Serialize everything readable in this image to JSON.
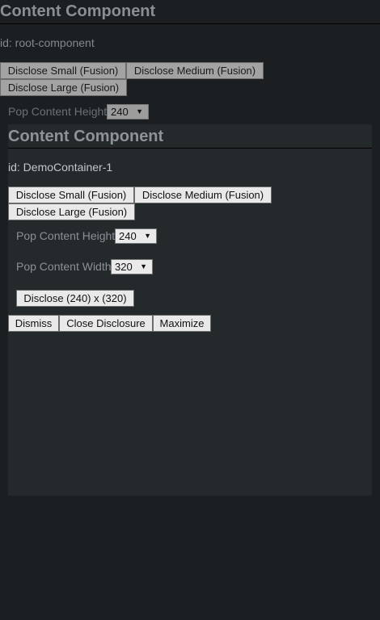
{
  "root": {
    "title": "Content Component",
    "id_text": "id: root-component",
    "buttons": {
      "disclose_small": "Disclose Small (Fusion)",
      "disclose_medium": "Disclose Medium (Fusion)",
      "disclose_large": "Disclose Large (Fusion)"
    },
    "pop_height_label": "Pop Content Height",
    "pop_height_value": "240"
  },
  "inner": {
    "title": "Content Component",
    "id_text": "id: DemoContainer-1",
    "buttons": {
      "disclose_small": "Disclose Small (Fusion)",
      "disclose_medium": "Disclose Medium (Fusion)",
      "disclose_large": "Disclose Large (Fusion)"
    },
    "pop_height_label": "Pop Content Height",
    "pop_height_value": "240",
    "pop_width_label": "Pop Content Width",
    "pop_width_value": "320",
    "disclose_sized": "Disclose (240) x (320)",
    "dismiss": "Dismiss",
    "close_disclosure": "Close Disclosure",
    "maximize": "Maximize"
  },
  "icons": {
    "dropdown": "▼"
  },
  "colors": {
    "background": "#1b1f22",
    "panel": "#24292c",
    "button_gray": "#a3a3a3",
    "button_light": "#e9e9e9"
  }
}
